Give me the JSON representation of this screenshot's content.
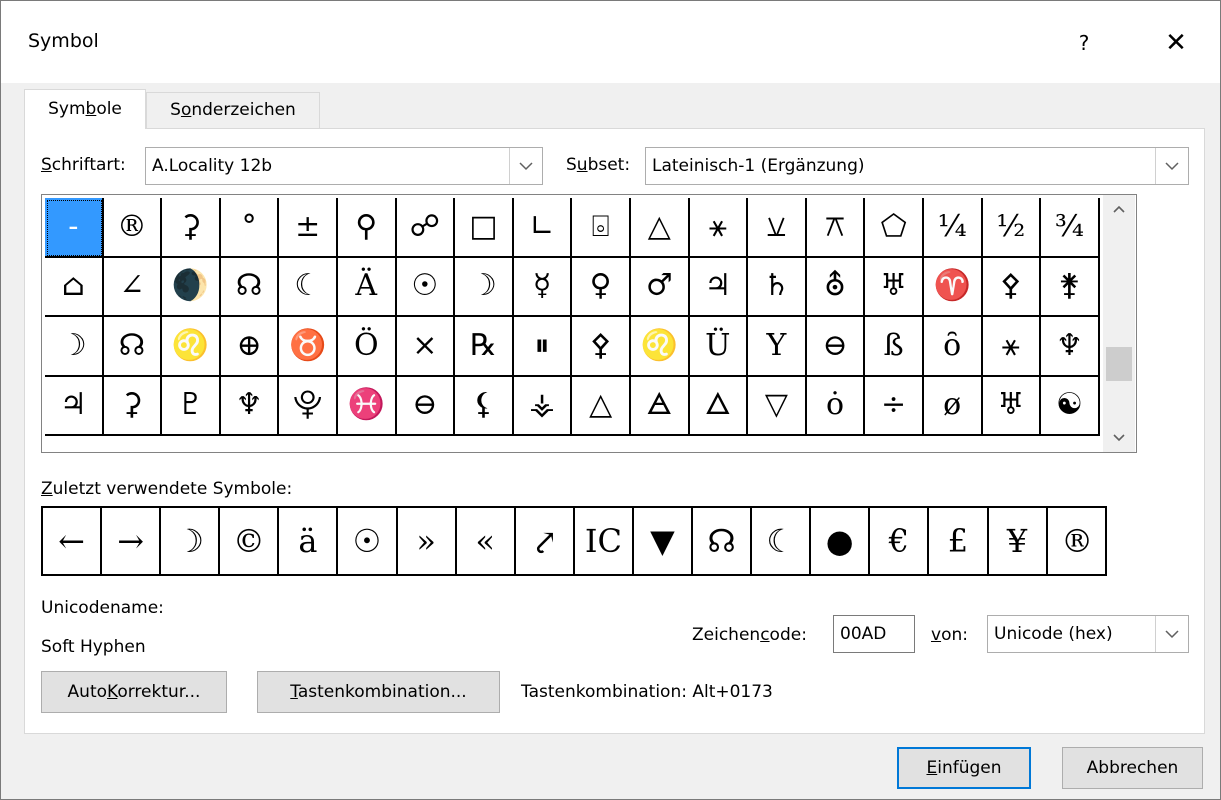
{
  "title": "Symbol",
  "title_buttons": {
    "help": "?",
    "close": "✕"
  },
  "tabs": [
    {
      "pre": "Sym",
      "u": "b",
      "post": "ole"
    },
    {
      "pre": "S",
      "u": "o",
      "post": "nderzeichen"
    }
  ],
  "font": {
    "label_u": "S",
    "label_post": "chriftart:",
    "value": "A.Locality 12b"
  },
  "subset": {
    "label_pre": "S",
    "label_u": "u",
    "label_post": "bset:",
    "value": "Lateinisch-1 (Ergänzung)"
  },
  "symbols": [
    [
      "-",
      "®",
      "⚳",
      "°",
      "±",
      "⚲",
      "☍",
      "□",
      "∟",
      "⌻",
      "△",
      "⚹",
      "⚺",
      "⚻",
      "⬠",
      "¼",
      "½",
      "¾"
    ],
    [
      "⌂",
      "∠",
      "🌒",
      "☊",
      "☾",
      "Ä",
      "☉",
      "☽",
      "☿",
      "♀",
      "♂",
      "♃",
      "♄",
      "⛢",
      "♅",
      "♈",
      "⚴",
      "⚵"
    ],
    [
      "☽",
      "☊",
      "♌",
      "⊕",
      "♉",
      "Ö",
      "×",
      "℞",
      "⏸",
      "⚴",
      "♌",
      "Ü",
      "Y",
      "⊖",
      "ß",
      "ȏ",
      "⚹",
      "♆"
    ],
    [
      "♃",
      "⚳",
      "♇",
      "♆",
      "⯓",
      "♓",
      "⊖",
      "⚸",
      "⚶",
      "△",
      "🜁",
      "🜂",
      "▽",
      "ȯ",
      "÷",
      "ø",
      "♅",
      "☯"
    ]
  ],
  "recent_label": {
    "u": "Z",
    "post": "uletzt verwendete Symbole:"
  },
  "recent": [
    "←",
    "→",
    "☽",
    "©",
    "ä",
    "☉",
    "»",
    "«",
    "⤤",
    "IC",
    "▼",
    "☊",
    "☾",
    "●",
    "€",
    "£",
    "¥",
    "®"
  ],
  "unicode_name_label": "Unicodename:",
  "unicode_name": "Soft Hyphen",
  "char_code": {
    "label_pre": "Zeichen",
    "label_u": "c",
    "label_post": "ode:",
    "value": "00AD"
  },
  "from": {
    "label_u": "v",
    "label_post": "on:",
    "value": "Unicode (hex)"
  },
  "buttons": {
    "autocorrect": {
      "pre": "Auto",
      "u": "K",
      "post": "orrektur..."
    },
    "shortcut": {
      "u": "T",
      "post": "astenkombination..."
    },
    "insert": {
      "u": "E",
      "post": "infügen"
    },
    "cancel": "Abbrechen"
  },
  "shortcut_text": "Tastenkombination: Alt+0173"
}
